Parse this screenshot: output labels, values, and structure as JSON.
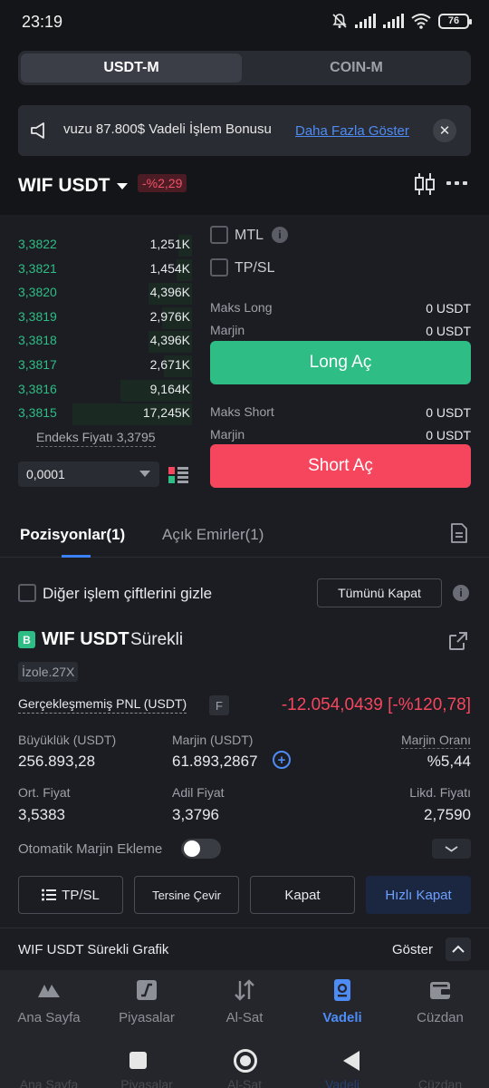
{
  "status_bar": {
    "time": "23:19",
    "battery": "76"
  },
  "segment": {
    "usdt_m": "USDT-M",
    "coin_m": "COIN-M"
  },
  "banner": {
    "marquee": "vuzu 87.800$ Vadeli İşlem Bonusu",
    "more_link": "Daha Fazla Göster"
  },
  "header": {
    "pair": "WIF USDT",
    "change": "-%2,29"
  },
  "orderbook": {
    "rows": [
      {
        "price": "3,3822",
        "qty": "1,251K",
        "depth": 0.08
      },
      {
        "price": "3,3821",
        "qty": "1,454K",
        "depth": 0.09
      },
      {
        "price": "3,3820",
        "qty": "4,396K",
        "depth": 0.25
      },
      {
        "price": "3,3819",
        "qty": "2,976K",
        "depth": 0.17
      },
      {
        "price": "3,3818",
        "qty": "4,396K",
        "depth": 0.25
      },
      {
        "price": "3,3817",
        "qty": "2,671K",
        "depth": 0.16
      },
      {
        "price": "3,3816",
        "qty": "9,164K",
        "depth": 0.41
      },
      {
        "price": "3,3815",
        "qty": "17,245K",
        "depth": 0.69
      }
    ],
    "index_price": "Endeks Fiyatı 3,3795",
    "step": "0,0001"
  },
  "order_form": {
    "mtl_label": "MTL",
    "tpsl_label": "TP/SL",
    "max_long_label": "Maks Long",
    "max_long_value": "0 USDT",
    "margin_label": "Marjin",
    "margin_long_value": "0 USDT",
    "long_button": "Long Aç",
    "max_short_label": "Maks Short",
    "max_short_value": "0 USDT",
    "margin_short_value": "0 USDT",
    "short_button": "Short Aç"
  },
  "tabs": {
    "positions": "Pozisyonlar(1)",
    "open_orders": "Açık Emirler(1)"
  },
  "filters": {
    "hide_pairs": "Diğer işlem çiftlerini gizle",
    "close_all": "Tümünü Kapat"
  },
  "position": {
    "side_badge": "B",
    "symbol": "WIF USDT",
    "contract": "Sürekli",
    "mode": "İzole.27X",
    "pnl_label": "Gerçekleşmemiş PNL (USDT)",
    "pnl_badge": "F",
    "pnl_value": "-12.054,0439 [-%120,78]",
    "size_label": "Büyüklük (USDT)",
    "size_value": "256.893,28",
    "margin_label": "Marjin (USDT)",
    "margin_value": "61.893,2867",
    "margin_ratio_label": "Marjin Oranı",
    "margin_ratio_value": "%5,44",
    "avg_price_label": "Ort. Fiyat",
    "avg_price_value": "3,5383",
    "fair_price_label": "Adil Fiyat",
    "fair_price_value": "3,3796",
    "liq_price_label": "Likd. Fiyatı",
    "liq_price_value": "2,7590",
    "auto_margin_label": "Otomatik Marjin Ekleme"
  },
  "actions": {
    "tpsl": "TP/SL",
    "reverse": "Tersine Çevir",
    "close": "Kapat",
    "quick_close": "Hızlı Kapat"
  },
  "chart_bar": {
    "title": "WIF USDT Sürekli Grafik",
    "show": "Göster"
  },
  "nav": {
    "home": "Ana Sayfa",
    "markets": "Piyasalar",
    "trade": "Al-Sat",
    "futures": "Vadeli",
    "wallet": "Cüzdan"
  },
  "colors": {
    "green": "#2ebd85",
    "red": "#f6465d",
    "blue": "#4d8cf5",
    "bg": "#1c1d22"
  }
}
